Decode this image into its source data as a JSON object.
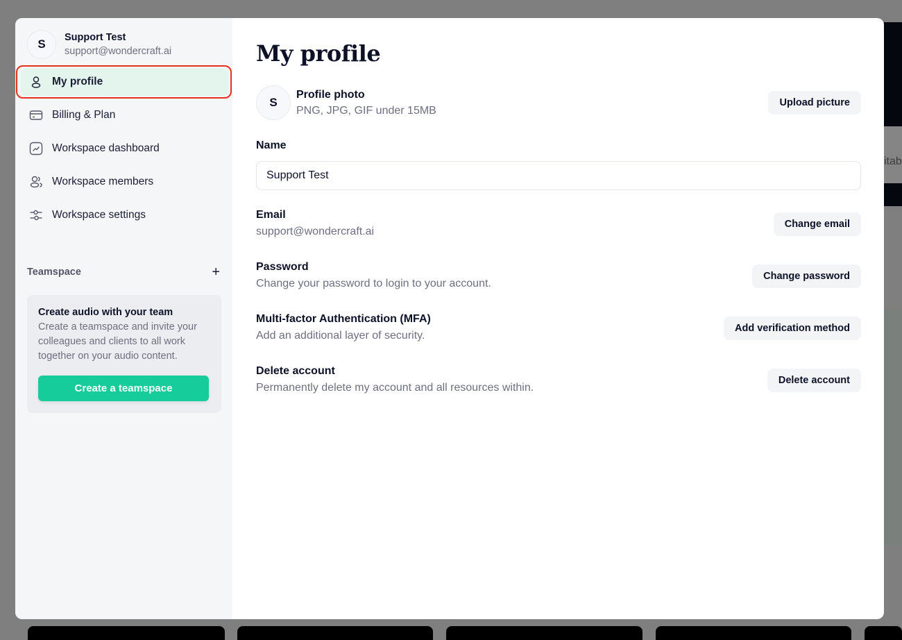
{
  "background": {
    "partial_text": "itab"
  },
  "sidebar": {
    "user": {
      "initial": "S",
      "name": "Support Test",
      "email": "support@wondercraft.ai"
    },
    "items": [
      {
        "label": "My profile",
        "icon": "user-icon",
        "active": true
      },
      {
        "label": "Billing & Plan",
        "icon": "credit-card-icon",
        "active": false
      },
      {
        "label": "Workspace dashboard",
        "icon": "chart-icon",
        "active": false
      },
      {
        "label": "Workspace members",
        "icon": "users-icon",
        "active": false
      },
      {
        "label": "Workspace settings",
        "icon": "sliders-icon",
        "active": false
      }
    ],
    "teamspace": {
      "label": "Teamspace",
      "add_icon": "plus-icon",
      "card": {
        "title": "Create audio with your team",
        "description": "Create a teamspace and invite your colleagues and clients to all work together on your audio content.",
        "button_label": "Create a teamspace"
      }
    }
  },
  "main": {
    "title": "My profile",
    "photo": {
      "initial": "S",
      "label": "Profile photo",
      "sub": "PNG, JPG, GIF under 15MB",
      "button": "Upload picture"
    },
    "name": {
      "label": "Name",
      "value": "Support Test"
    },
    "email": {
      "label": "Email",
      "value": "support@wondercraft.ai",
      "button": "Change email"
    },
    "password": {
      "label": "Password",
      "sub": "Change your password to login to your account.",
      "button": "Change password"
    },
    "mfa": {
      "label": "Multi-factor Authentication (MFA)",
      "sub": "Add an additional layer of security.",
      "button": "Add verification method"
    },
    "delete": {
      "label": "Delete account",
      "sub": "Permanently delete my account and all resources within.",
      "button": "Delete account"
    }
  },
  "colors": {
    "accent": "#16cc9a",
    "active_bg": "#e4f5ee",
    "highlight": "#e5321f"
  }
}
